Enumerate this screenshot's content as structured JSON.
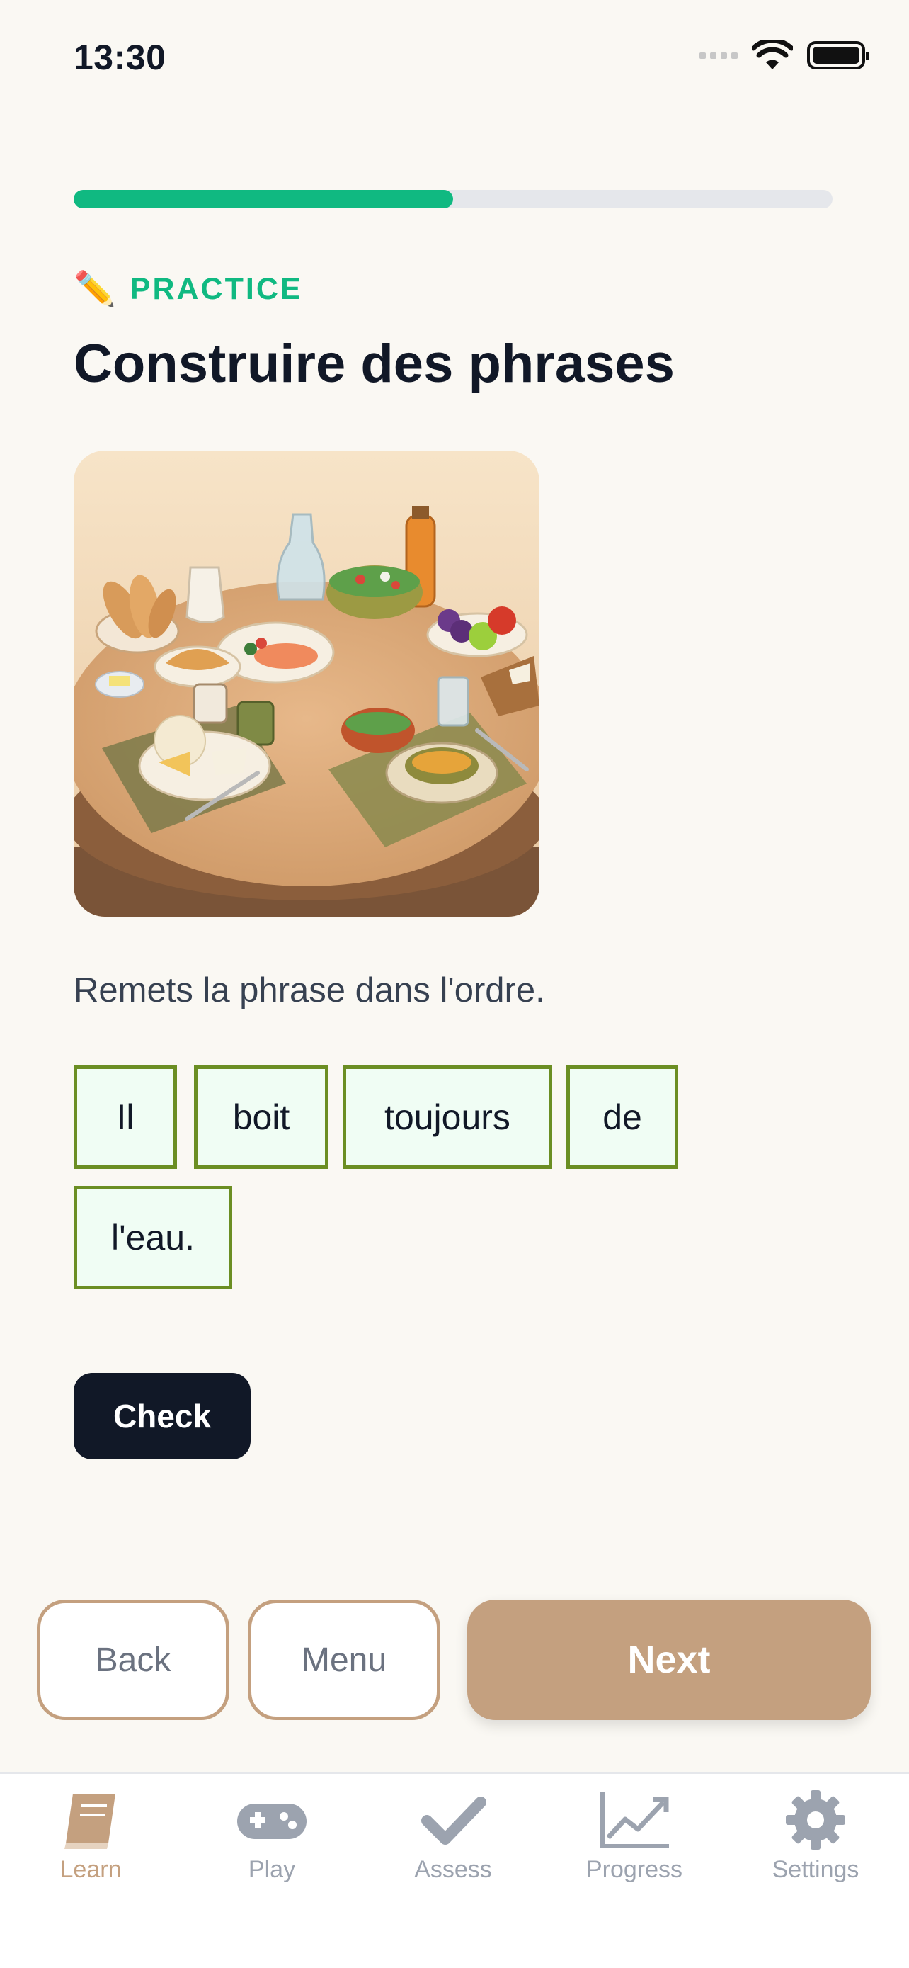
{
  "status_bar": {
    "time": "13:30"
  },
  "progress": {
    "fraction": 0.5
  },
  "header": {
    "kicker_icon": "pencil-icon",
    "kicker": "PRACTICE",
    "title": "Construire des phrases"
  },
  "illustration": {
    "icon": "dining-table-food-illustration"
  },
  "exercise": {
    "instruction": "Remets la phrase dans l'ordre.",
    "tiles": [
      "Il",
      "boit",
      "toujours",
      "de",
      "l'eau."
    ],
    "check_label": "Check"
  },
  "navigation": {
    "back_label": "Back",
    "menu_label": "Menu",
    "next_label": "Next"
  },
  "tabbar": {
    "items": [
      {
        "label": "Learn",
        "icon": "book-icon",
        "active": true
      },
      {
        "label": "Play",
        "icon": "gamepad-icon",
        "active": false
      },
      {
        "label": "Assess",
        "icon": "checkmark-icon",
        "active": false
      },
      {
        "label": "Progress",
        "icon": "chart-icon",
        "active": false
      },
      {
        "label": "Settings",
        "icon": "gear-icon",
        "active": false
      }
    ]
  },
  "colors": {
    "accent": "#10b981",
    "tile_border": "#6b8e23",
    "brand_tan": "#c4a07f",
    "dark": "#111827"
  }
}
